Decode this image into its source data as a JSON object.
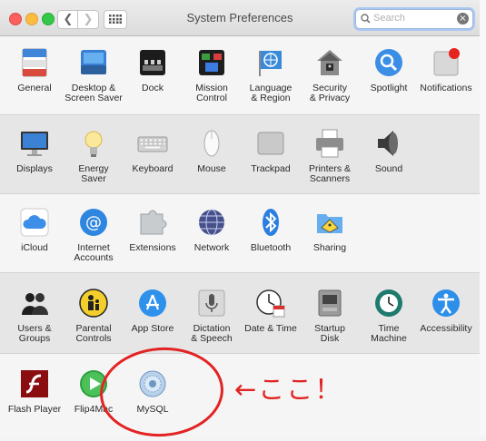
{
  "window": {
    "title": "System Preferences"
  },
  "search": {
    "placeholder": "Search"
  },
  "rows": [
    {
      "items": [
        {
          "name": "general",
          "label": "General",
          "icon": "general-icon"
        },
        {
          "name": "desktop",
          "label": "Desktop &\nScreen Saver",
          "icon": "desktop-icon"
        },
        {
          "name": "dock",
          "label": "Dock",
          "icon": "dock-icon"
        },
        {
          "name": "mission-control",
          "label": "Mission\nControl",
          "icon": "mission-control-icon"
        },
        {
          "name": "language",
          "label": "Language\n& Region",
          "icon": "globe-flag-icon"
        },
        {
          "name": "security",
          "label": "Security\n& Privacy",
          "icon": "house-lock-icon"
        },
        {
          "name": "spotlight",
          "label": "Spotlight",
          "icon": "magnifier-icon"
        },
        {
          "name": "notifications",
          "label": "Notifications",
          "icon": "notifications-icon"
        }
      ]
    },
    {
      "items": [
        {
          "name": "displays",
          "label": "Displays",
          "icon": "monitor-icon"
        },
        {
          "name": "energy",
          "label": "Energy\nSaver",
          "icon": "lightbulb-icon"
        },
        {
          "name": "keyboard",
          "label": "Keyboard",
          "icon": "keyboard-icon"
        },
        {
          "name": "mouse",
          "label": "Mouse",
          "icon": "mouse-icon"
        },
        {
          "name": "trackpad",
          "label": "Trackpad",
          "icon": "trackpad-icon"
        },
        {
          "name": "printers",
          "label": "Printers &\nScanners",
          "icon": "printer-icon"
        },
        {
          "name": "sound",
          "label": "Sound",
          "icon": "speaker-icon"
        }
      ]
    },
    {
      "items": [
        {
          "name": "icloud",
          "label": "iCloud",
          "icon": "cloud-icon"
        },
        {
          "name": "internet-accounts",
          "label": "Internet\nAccounts",
          "icon": "at-sign-icon"
        },
        {
          "name": "extensions",
          "label": "Extensions",
          "icon": "puzzle-icon"
        },
        {
          "name": "network",
          "label": "Network",
          "icon": "network-globe-icon"
        },
        {
          "name": "bluetooth",
          "label": "Bluetooth",
          "icon": "bluetooth-icon"
        },
        {
          "name": "sharing",
          "label": "Sharing",
          "icon": "shared-folder-icon"
        }
      ]
    },
    {
      "items": [
        {
          "name": "users",
          "label": "Users &\nGroups",
          "icon": "users-icon"
        },
        {
          "name": "parental",
          "label": "Parental\nControls",
          "icon": "parental-controls-icon"
        },
        {
          "name": "app-store",
          "label": "App Store",
          "icon": "app-store-icon"
        },
        {
          "name": "dictation",
          "label": "Dictation\n& Speech",
          "icon": "microphone-icon"
        },
        {
          "name": "date-time",
          "label": "Date & Time",
          "icon": "clock-calendar-icon"
        },
        {
          "name": "startup-disk",
          "label": "Startup\nDisk",
          "icon": "disk-icon"
        },
        {
          "name": "time-machine",
          "label": "Time\nMachine",
          "icon": "time-machine-icon"
        },
        {
          "name": "accessibility",
          "label": "Accessibility",
          "icon": "accessibility-icon"
        }
      ]
    },
    {
      "items": [
        {
          "name": "flash-player",
          "label": "Flash Player",
          "icon": "flash-icon"
        },
        {
          "name": "flip4mac",
          "label": "Flip4Mac",
          "icon": "flip4mac-icon"
        },
        {
          "name": "mysql",
          "label": "MySQL",
          "icon": "mysql-icon"
        }
      ]
    }
  ],
  "annotation": {
    "text": "←ここ！",
    "color": "#e32323"
  }
}
